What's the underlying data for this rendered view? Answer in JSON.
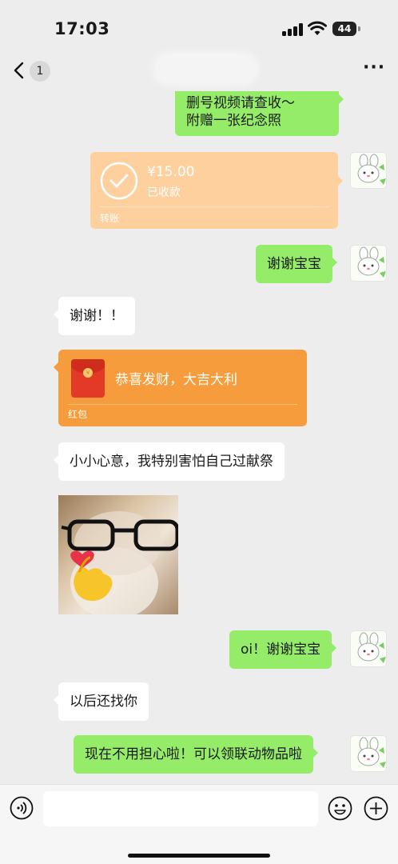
{
  "status_bar": {
    "time": "17:03",
    "battery_level": "44",
    "icons": [
      "signal-icon",
      "wifi-icon",
      "battery-icon"
    ]
  },
  "nav": {
    "unread_count": "1",
    "icons": [
      "back-chevron-icon",
      "more-icon"
    ]
  },
  "messages": {
    "m1": {
      "sender": "me",
      "type": "text",
      "line1": "删号视频请查收～",
      "line2": "附赠一张纪念照"
    },
    "m2": {
      "sender": "me",
      "type": "transfer",
      "amount": "¥15.00",
      "status": "已收款",
      "label": "转账"
    },
    "m3": {
      "sender": "me",
      "type": "text",
      "text": "谢谢宝宝"
    },
    "m4": {
      "sender": "other",
      "type": "text",
      "text": "谢谢！！"
    },
    "m5": {
      "sender": "other",
      "type": "red_packet",
      "greeting": "恭喜发财，大吉大利",
      "label": "红包"
    },
    "m6": {
      "sender": "other",
      "type": "text",
      "text": "小小心意，我特别害怕自己过献祭"
    },
    "m7": {
      "sender": "other",
      "type": "sticker",
      "description_icon": "cat-glasses-heart-sticker"
    },
    "m8": {
      "sender": "me",
      "type": "text",
      "text": "oi！谢谢宝宝"
    },
    "m9": {
      "sender": "other",
      "type": "text",
      "text": "以后还找你"
    },
    "m10": {
      "sender": "me",
      "type": "text",
      "text": "现在不用担心啦！可以领联动物品啦"
    }
  },
  "input_bar": {
    "placeholder": "",
    "icons": [
      "voice-icon",
      "emoji-icon",
      "plus-icon"
    ]
  },
  "colors": {
    "background": "#ededed",
    "my_bubble": "#95ec69",
    "their_bubble": "#ffffff",
    "transfer_received": "#fdd09e",
    "red_packet": "#f79c3c"
  }
}
